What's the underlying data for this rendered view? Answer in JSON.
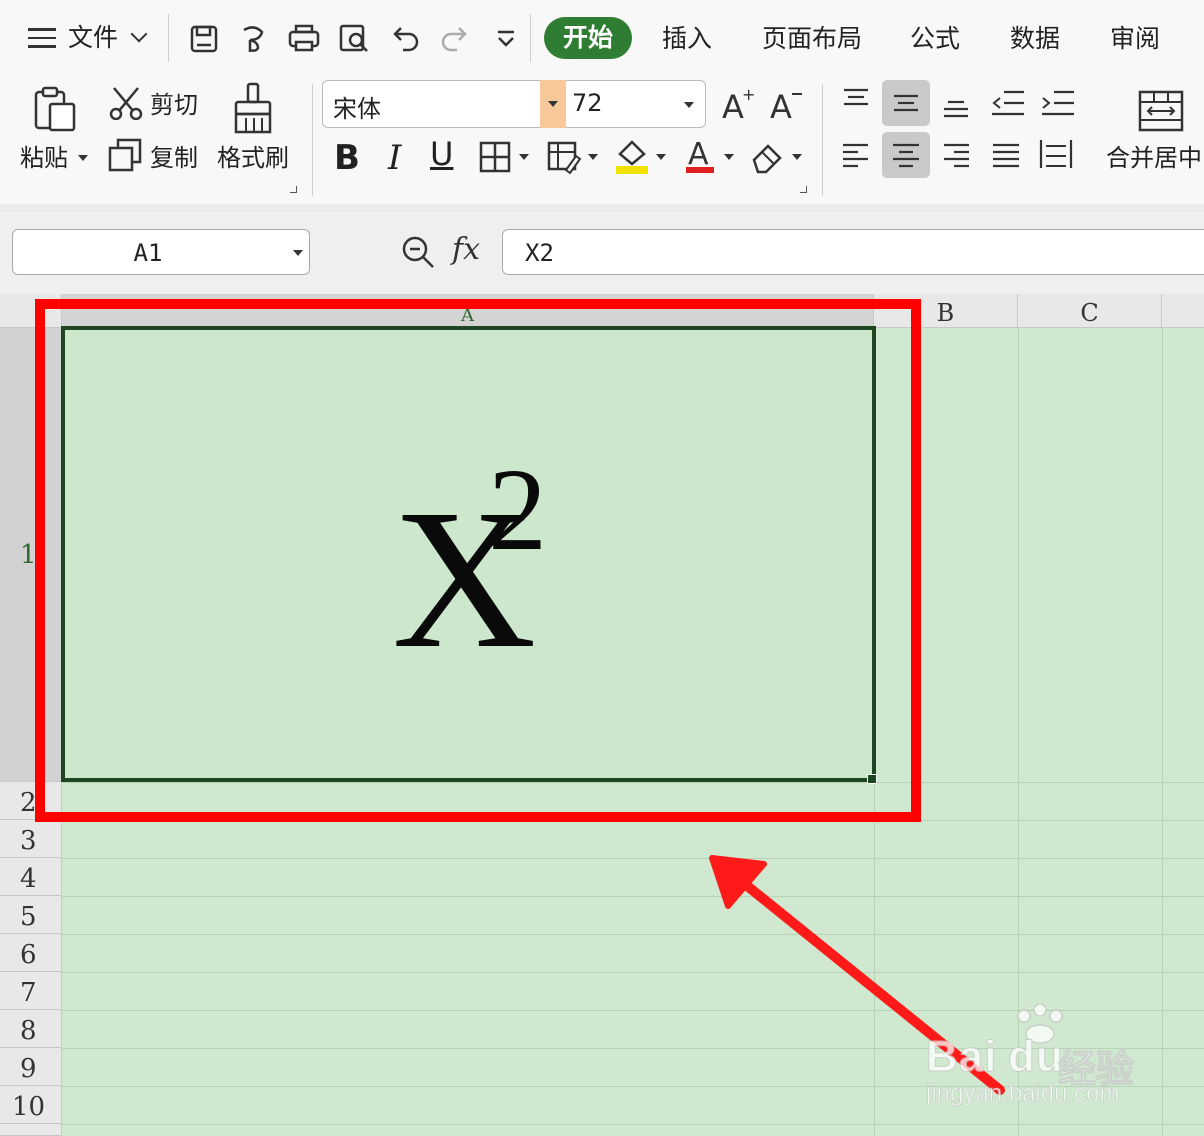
{
  "menubar": {
    "file_label": "文件",
    "tabs": [
      {
        "label": "开始",
        "active": true
      },
      {
        "label": "插入"
      },
      {
        "label": "页面布局"
      },
      {
        "label": "公式"
      },
      {
        "label": "数据"
      },
      {
        "label": "审阅"
      }
    ],
    "quick_access_icons": [
      "save-icon",
      "format-painter-icon",
      "print-icon",
      "print-preview-icon",
      "undo-icon",
      "redo-icon",
      "customize-dropdown-icon"
    ]
  },
  "ribbon": {
    "paste_label": "粘贴",
    "cut_label": "剪切",
    "copy_label": "复制",
    "format_painter_label": "格式刷",
    "font_name": "宋体",
    "font_size": "72",
    "bold_label": "B",
    "italic_label": "I",
    "underline_label": "U",
    "merge_center_label": "合并居中",
    "font_color": "#e02020",
    "highlight_color": "#f2e000"
  },
  "formula_bar": {
    "name_box": "A1",
    "fx_label": "fx",
    "formula": "X2"
  },
  "grid": {
    "columns": [
      "A",
      "B",
      "C"
    ],
    "rows": [
      "1",
      "2",
      "3",
      "4",
      "5",
      "6",
      "7",
      "8",
      "9",
      "10"
    ],
    "selected_cell": "A1",
    "cell_a1": {
      "base": "X",
      "superscript": "2"
    },
    "cell_fill_color": "#cfe8cf",
    "selection_border_color": "#1e4620"
  },
  "annotation": {
    "highlight_color": "#ff0000"
  },
  "watermark": {
    "logo": "Bai",
    "logo_du": "du",
    "brand_cn": "经验",
    "url": "jingyan.baidu.com"
  }
}
